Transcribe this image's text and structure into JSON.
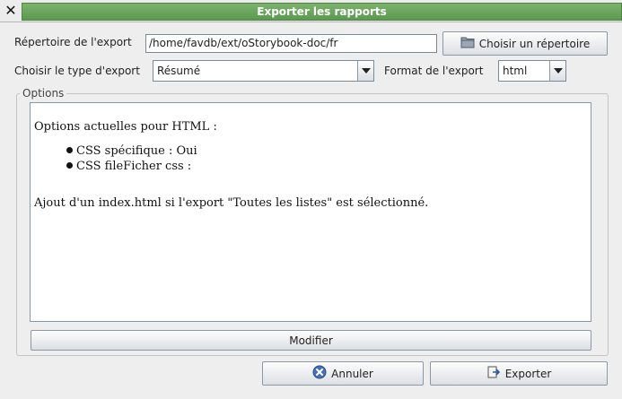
{
  "window": {
    "title": "Exporter les rapports",
    "close_icon": "close-icon"
  },
  "form": {
    "directory_label": "Répertoire de l'export",
    "directory_value": "/home/favdb/ext/oStorybook-doc/fr",
    "choose_dir_button": "Choisir un répertoire",
    "export_type_label": "Choisir le type d'export",
    "export_type_value": "Résumé",
    "format_label": "Format de l'export",
    "format_value": "html"
  },
  "options": {
    "legend": "Options",
    "heading": "Options actuelles pour HTML :",
    "items": [
      "CSS spécifique : Oui",
      "CSS fileFicher css :"
    ],
    "note": "Ajout d'un index.html si l'export \"Toutes les listes\" est sélectionné.",
    "modify_button": "Modifier"
  },
  "footer": {
    "cancel_button": "Annuler",
    "export_button": "Exporter"
  }
}
